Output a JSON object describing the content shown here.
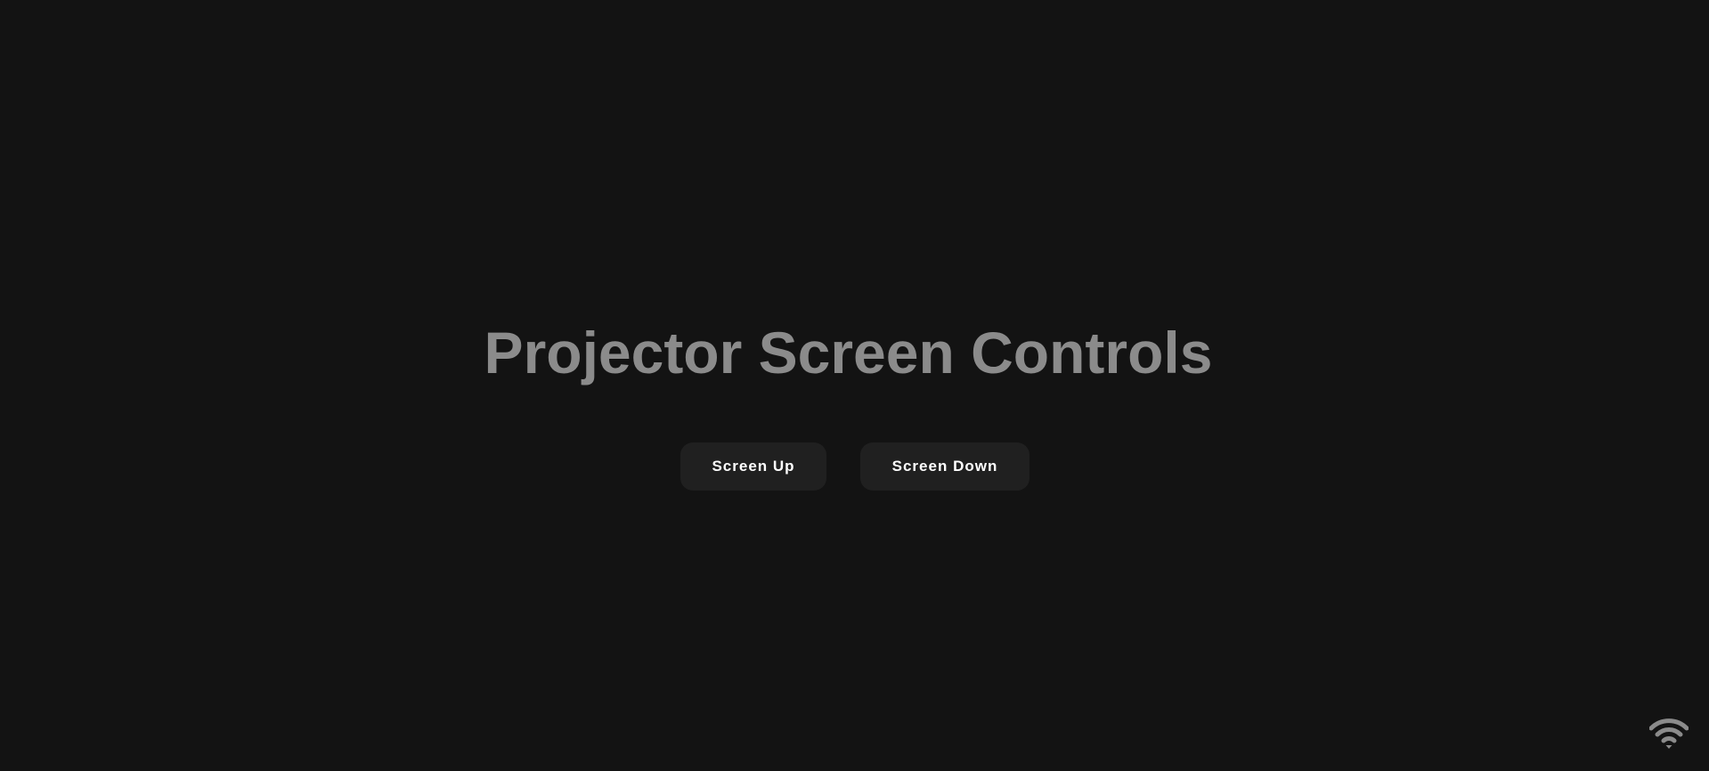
{
  "header": {
    "title": "Projector Screen Controls"
  },
  "controls": {
    "screen_up_label": "Screen Up",
    "screen_down_label": "Screen Down"
  },
  "status": {
    "connection_icon": "wifi-icon"
  },
  "colors": {
    "background": "#131313",
    "title": "#8b8b8b",
    "button_background": "#202020",
    "button_text": "#ffffff",
    "icon": "#8b8b8b"
  }
}
